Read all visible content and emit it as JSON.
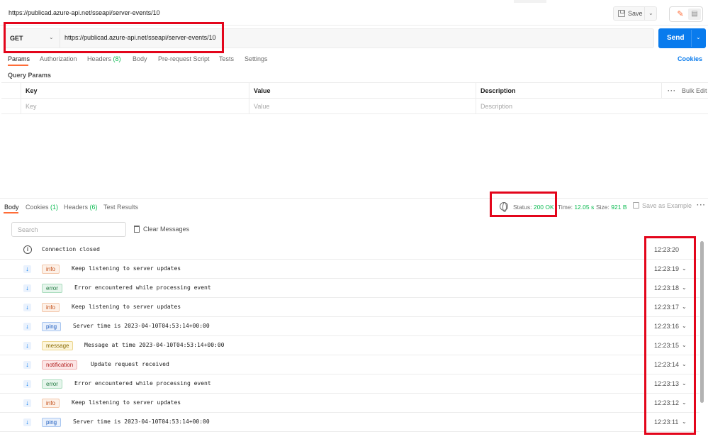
{
  "request": {
    "title": "https://publicad.azure-api.net/sseapi/server-events/10",
    "save_label": "Save",
    "method": "GET",
    "url": "https://publicad.azure-api.net/sseapi/server-events/10",
    "send_label": "Send"
  },
  "request_tabs": [
    {
      "label": "Params",
      "count": ""
    },
    {
      "label": "Authorization",
      "count": ""
    },
    {
      "label": "Headers",
      "count": "(8)"
    },
    {
      "label": "Body",
      "count": ""
    },
    {
      "label": "Pre-request Script",
      "count": ""
    },
    {
      "label": "Tests",
      "count": ""
    },
    {
      "label": "Settings",
      "count": ""
    }
  ],
  "cookies_link": "Cookies",
  "query_params": {
    "section_label": "Query Params",
    "columns": [
      "Key",
      "Value",
      "Description"
    ],
    "placeholders": [
      "Key",
      "Value",
      "Description"
    ],
    "bulk_edit": "Bulk Edit"
  },
  "response_tabs": [
    {
      "label": "Body",
      "count": ""
    },
    {
      "label": "Cookies",
      "count": "(1)"
    },
    {
      "label": "Headers",
      "count": "(6)"
    },
    {
      "label": "Test Results",
      "count": ""
    }
  ],
  "response_status": {
    "status_label": "Status:",
    "status_value": "200 OK",
    "time_label": "Time:",
    "time_value": "12.05 s",
    "size_label": "Size:",
    "size_value": "921 B",
    "save_example": "Save as Example"
  },
  "events_toolbar": {
    "search_placeholder": "Search",
    "clear_label": "Clear Messages"
  },
  "events": [
    {
      "type": "",
      "message": "Connection closed",
      "time": "12:23:20"
    },
    {
      "type": "info",
      "message": "Keep listening to server updates",
      "time": "12:23:19"
    },
    {
      "type": "error",
      "message": "Error encountered while processing event",
      "time": "12:23:18"
    },
    {
      "type": "info",
      "message": "Keep listening to server updates",
      "time": "12:23:17"
    },
    {
      "type": "ping",
      "message": "Server time is 2023-04-10T04:53:14+00:00",
      "time": "12:23:16"
    },
    {
      "type": "message",
      "message": "Message at time 2023-04-10T04:53:14+00:00",
      "time": "12:23:15"
    },
    {
      "type": "notification",
      "message": "Update request received",
      "time": "12:23:14"
    },
    {
      "type": "error",
      "message": "Error encountered while processing event",
      "time": "12:23:13"
    },
    {
      "type": "info",
      "message": "Keep listening to server updates",
      "time": "12:23:12"
    },
    {
      "type": "ping",
      "message": "Server time is 2023-04-10T04:53:14+00:00",
      "time": "12:23:11"
    }
  ],
  "colors": {
    "accent": "#ff6c37",
    "send_button": "#097bed",
    "status_ok": "#0cbb52",
    "highlight_box": "#e3051b"
  }
}
